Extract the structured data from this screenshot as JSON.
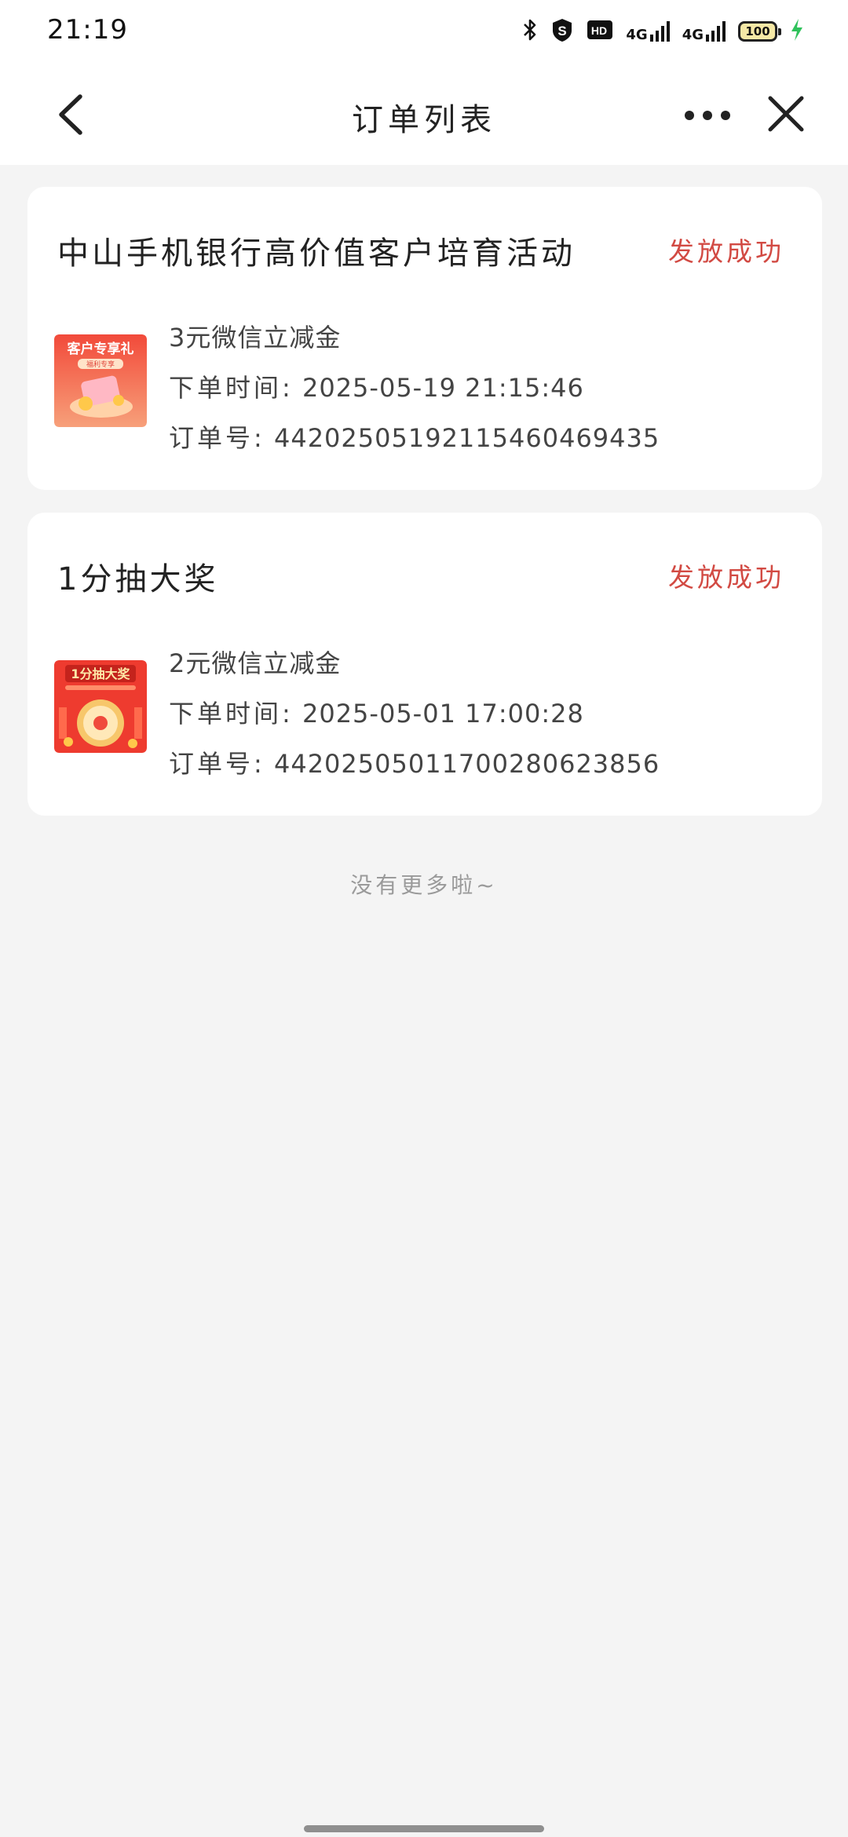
{
  "status_bar": {
    "time": "21:19",
    "icons": [
      "bluetooth-icon",
      "s-app-icon",
      "hd-icon",
      "signal-4g-icon",
      "signal-4g-icon",
      "battery-icon",
      "charging-icon"
    ],
    "network_1": "4G",
    "network_2": "4G",
    "hd_label": "HD",
    "battery_level": "100"
  },
  "nav": {
    "title": "订单列表"
  },
  "orders": [
    {
      "title": "中山手机银行高价值客户培育活动",
      "status": "发放成功",
      "status_color": "#d24a43",
      "thumb_banner": "客户专享礼",
      "thumb_sub": "福利专享",
      "item": "3元微信立减金",
      "time_label": "下单时间:",
      "time": "2025-05-19 21:15:46",
      "order_label": "订单号:",
      "order_no": "4420250519211546046943​5"
    },
    {
      "title": "1分抽大奖",
      "status": "发放成功",
      "status_color": "#d24a43",
      "thumb_banner": "1分抽大奖",
      "item": "2元微信立减金",
      "time_label": "下单时间:",
      "time": "2025-05-01 17:00:28",
      "order_label": "订单号:",
      "order_no": "442025050117002806238​56"
    }
  ],
  "footer": {
    "note": "没有更多啦~"
  }
}
